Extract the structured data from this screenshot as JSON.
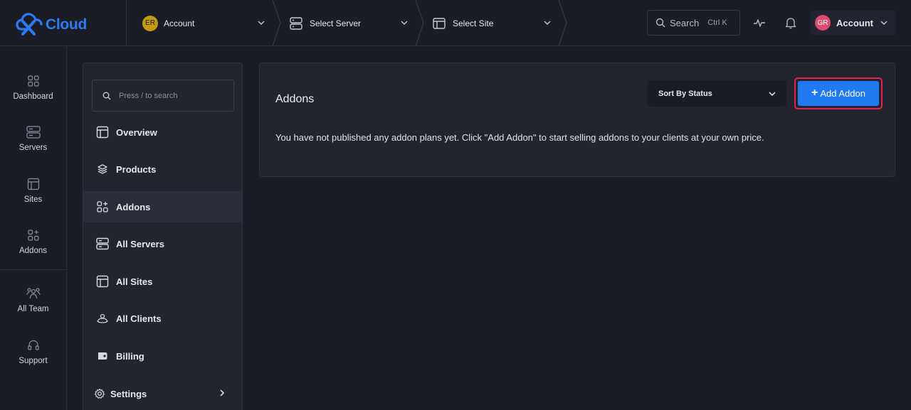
{
  "brand": {
    "name": "Cloud"
  },
  "breadcrumbs": {
    "account": {
      "badge": "ER",
      "label": "Account"
    },
    "server": {
      "label": "Select Server"
    },
    "site": {
      "label": "Select Site"
    }
  },
  "topbar": {
    "search_label": "Search",
    "search_shortcut": "Ctrl K",
    "account_badge": "GR",
    "account_label": "Account"
  },
  "rail": {
    "items": [
      {
        "label": "Dashboard",
        "icon": "dashboard-icon"
      },
      {
        "label": "Servers",
        "icon": "server-icon"
      },
      {
        "label": "Sites",
        "icon": "site-icon"
      },
      {
        "label": "Addons",
        "icon": "addons-icon"
      },
      {
        "label": "All Team",
        "icon": "team-icon"
      },
      {
        "label": "Support",
        "icon": "headset-icon"
      }
    ]
  },
  "subnav": {
    "search_placeholder": "Press / to search",
    "items": [
      {
        "label": "Overview",
        "icon": "layout-icon"
      },
      {
        "label": "Products",
        "icon": "layers-icon"
      },
      {
        "label": "Addons",
        "icon": "addons-icon",
        "active": true
      },
      {
        "label": "All Servers",
        "icon": "server-icon"
      },
      {
        "label": "All Sites",
        "icon": "layout-icon"
      },
      {
        "label": "All Clients",
        "icon": "clients-icon"
      },
      {
        "label": "Billing",
        "icon": "billing-icon"
      },
      {
        "label": "Settings",
        "icon": "gear-icon"
      }
    ]
  },
  "main": {
    "title": "Addons",
    "sort_label": "Sort By Status",
    "add_button_label": "Add Addon",
    "empty_message": "You have not published any addon plans yet. Click \"Add Addon\" to start selling addons to your clients at your own price."
  },
  "colors": {
    "accent": "#1f7af1",
    "highlight": "#e0244f",
    "background": "#1b1d26",
    "panel": "#22252e"
  }
}
